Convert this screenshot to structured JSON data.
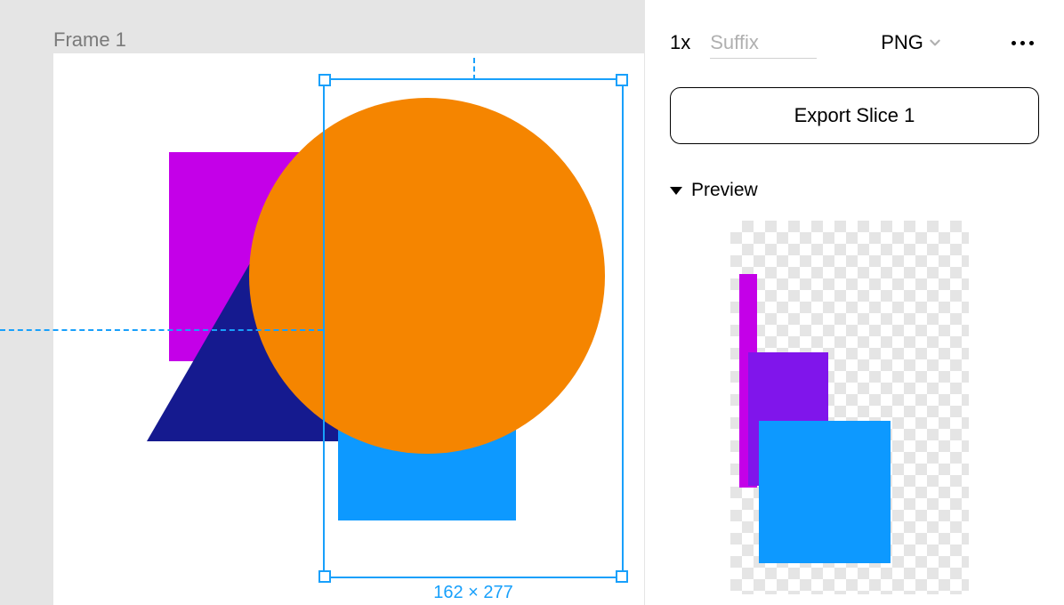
{
  "canvas": {
    "frame_label": "Frame 1",
    "selection_dimensions": "162 × 277",
    "shapes": {
      "rect_magenta": {
        "color": "#c400e8"
      },
      "triangle_navy": {
        "color": "#151a8f"
      },
      "rect_blue": {
        "color": "#0d99ff"
      },
      "circle_orange": {
        "color": "#f58500"
      }
    }
  },
  "export": {
    "scale": "1x",
    "suffix_placeholder": "Suffix",
    "suffix_value": "",
    "format": "PNG",
    "button_label": "Export Slice 1"
  },
  "preview": {
    "label": "Preview"
  }
}
